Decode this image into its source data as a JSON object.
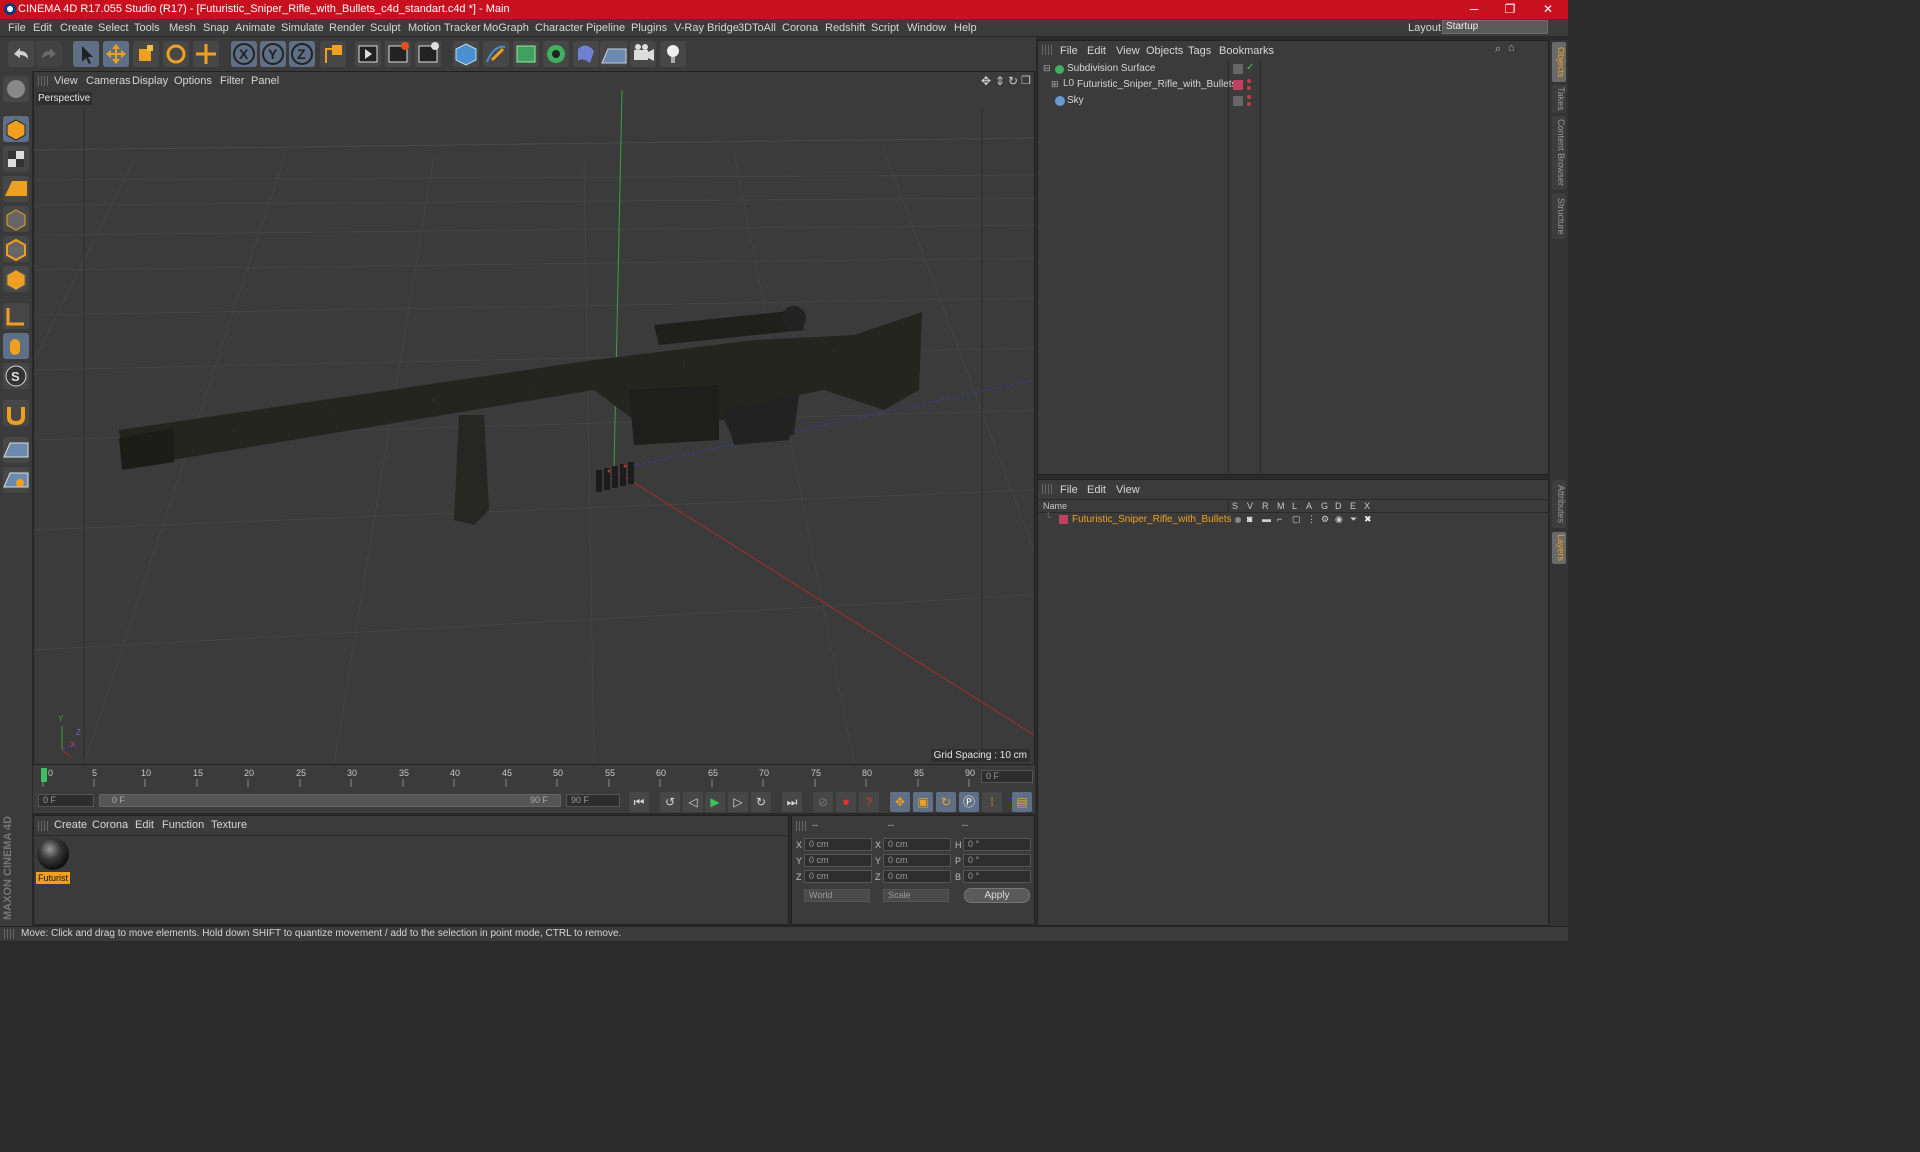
{
  "window": {
    "title": "CINEMA 4D R17.055 Studio (R17) - [Futuristic_Sniper_Rifle_with_Bullets_c4d_standart.c4d *] - Main",
    "minimize": "─",
    "maximize": "❐",
    "close": "✕"
  },
  "menu": [
    "File",
    "Edit",
    "Create",
    "Select",
    "Tools",
    "Mesh",
    "Snap",
    "Animate",
    "Simulate",
    "Render",
    "Sculpt",
    "Motion Tracker",
    "MoGraph",
    "Character",
    "Pipeline",
    "Plugins",
    "V-Ray Bridge",
    "3DToAll",
    "Corona",
    "Redshift",
    "Script",
    "Window",
    "Help"
  ],
  "layout": {
    "label": "Layout:",
    "value": "Startup"
  },
  "toolbar": {
    "icons": [
      "undo-icon",
      "redo-icon",
      "select-arrow-icon",
      "move-icon",
      "scale-icon",
      "rotate-icon",
      "move-plus-icon",
      "x-axis-icon",
      "y-axis-icon",
      "z-axis-icon",
      "coordinate-system-icon",
      "render-view-icon",
      "render-picture-viewer-icon",
      "edit-render-settings-icon",
      "cube-icon",
      "pen-icon",
      "subdivision-icon",
      "mograph-cloner-icon",
      "deformer-icon",
      "floor-icon",
      "camera-icon",
      "light-icon"
    ],
    "axis": {
      "x": "X",
      "y": "Y",
      "z": "Z"
    }
  },
  "viewport": {
    "menu": [
      "View",
      "Cameras",
      "Display",
      "Options",
      "Filter",
      "Panel"
    ],
    "label": "Perspective",
    "grid_spacing": "Grid Spacing : 10 cm",
    "axis_x": "X",
    "axis_y": "Y",
    "axis_z": "Z"
  },
  "timeline": {
    "ticks": [
      "0",
      "5",
      "10",
      "15",
      "20",
      "25",
      "30",
      "35",
      "40",
      "45",
      "50",
      "55",
      "60",
      "65",
      "70",
      "75",
      "80",
      "85",
      "90"
    ],
    "current_frame": "0 F",
    "start_field": "0 F",
    "slider_start": "0 F",
    "slider_end": "90 F",
    "end_field": "90 F"
  },
  "material_manager": {
    "menu": [
      "Create",
      "Corona",
      "Edit",
      "Function",
      "Texture"
    ],
    "material_name": "Futurist"
  },
  "coordinates": {
    "headers": [
      "--",
      "--",
      "--"
    ],
    "rows": [
      {
        "l1": "X",
        "v1": "0 cm",
        "l2": "X",
        "v2": "0 cm",
        "l3": "H",
        "v3": "0 °"
      },
      {
        "l1": "Y",
        "v1": "0 cm",
        "l2": "Y",
        "v2": "0 cm",
        "l3": "P",
        "v3": "0 °"
      },
      {
        "l1": "Z",
        "v1": "0 cm",
        "l2": "Z",
        "v2": "0 cm",
        "l3": "B",
        "v3": "0 °"
      }
    ],
    "mode1": "World",
    "mode2": "Scale",
    "apply": "Apply"
  },
  "object_manager": {
    "menu": [
      "File",
      "Edit",
      "View",
      "Objects",
      "Tags",
      "Bookmarks"
    ],
    "objects": [
      "Subdivision Surface",
      "Futuristic_Sniper_Rifle_with_Bullets",
      "Sky"
    ]
  },
  "layer_manager": {
    "menu": [
      "File",
      "Edit",
      "View"
    ],
    "columns": [
      "Name",
      "S",
      "V",
      "R",
      "M",
      "L",
      "A",
      "G",
      "D",
      "E",
      "X"
    ],
    "layer": "Futuristic_Sniper_Rifle_with_Bullets"
  },
  "right_tabs": [
    "Objects",
    "Takes",
    "Content Browser",
    "Structure",
    "Attributes",
    "Layers"
  ],
  "branding": "MAXON CINEMA 4D",
  "status": "Move: Click and drag to move elements. Hold down SHIFT to quantize movement / add to the selection in point mode, CTRL to remove.",
  "colors": {
    "title_bar": "#c8101e",
    "layer_name": "#f0a020",
    "accent": "#f0a020",
    "tool_blue": "#4a7ab0"
  }
}
